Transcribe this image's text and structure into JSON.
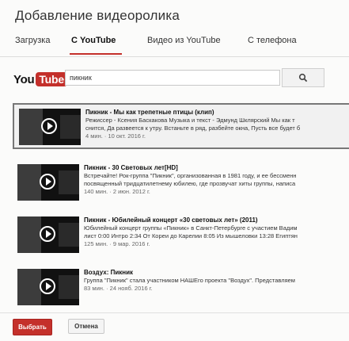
{
  "dialog": {
    "title": "Добавление видеоролика"
  },
  "tabs": [
    {
      "label": "Загрузка"
    },
    {
      "label": "С YouTube",
      "active": true
    },
    {
      "label": "Видео из YouTube"
    },
    {
      "label": "С телефона"
    }
  ],
  "logo": {
    "you": "You",
    "tube": "Tube"
  },
  "search": {
    "value": "пикник",
    "icon": "search-icon"
  },
  "results": [
    {
      "title": "Пикник - Мы как трепетные птицы (клип)",
      "desc1": "Режиссер - Ксения Баскакова Музыка и текст - Эдмунд Шклярский Мы как т",
      "desc2": "снится, Да развеется к утру. Встаньте в ряд, разбейте окна, Пусть все будет б",
      "meta": "4 мин. · 10 окт. 2016 г.",
      "selected": true
    },
    {
      "title": "Пикник - 30 Световых лет[HD]",
      "desc1": "Встречайте! Рок-группа \"Пикник\", организованная в 1981 году, и ее бессменн",
      "desc2": "посвященный тридцатилетнему юбилею, где прозвучат хиты группы, написа",
      "meta": "140 мин. · 2 июн. 2012 г."
    },
    {
      "title": "Пикник - Юбилейный концерт «30 световых лет» (2011)",
      "desc1": "Юбилейный концерт группы «Пикник» в Санкт-Петербурге с участием Вадим",
      "desc2": "лист 0:00 Интро 2:34 От Кореи до Карелии 8:05 Из мышеловки 13:28 Египтян",
      "meta": "125 мин. · 9 мар. 2016 г."
    },
    {
      "title": "Воздух: Пикник",
      "desc1": "Группа \"Пикник\" стала участником НАШЕго проекта \"Воздух\". Представляем",
      "desc2": "",
      "meta": "83 мин. · 24 нояб. 2016 г."
    }
  ],
  "footer": {
    "select_label": "Выбрать",
    "cancel_label": "Отмена"
  },
  "colors": {
    "accent": "#c4302b"
  }
}
